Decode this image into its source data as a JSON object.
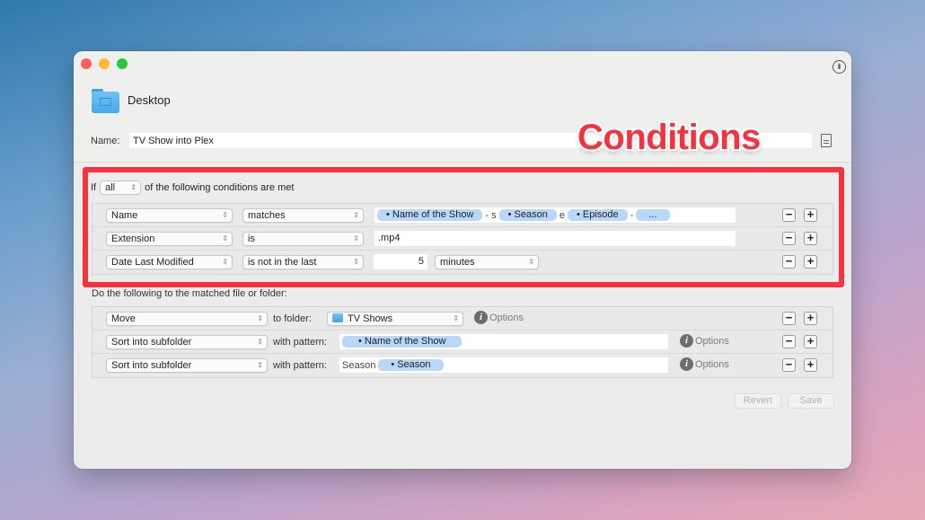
{
  "window": {
    "location": "Desktop",
    "name_label": "Name:",
    "name_value": "TV Show into Plex"
  },
  "conditions": {
    "if_prefix": "If",
    "match_mode": "all",
    "if_suffix": "of the following conditions are met",
    "rows": [
      {
        "attribute": "Name",
        "operator": "matches",
        "pattern": [
          {
            "type": "token",
            "text": "• Name of the Show"
          },
          {
            "type": "text",
            "text": "- s"
          },
          {
            "type": "token",
            "text": "• Season"
          },
          {
            "type": "text",
            "text": "e"
          },
          {
            "type": "token",
            "text": "• Episode"
          },
          {
            "type": "text",
            "text": "-"
          },
          {
            "type": "token",
            "text": "..."
          }
        ]
      },
      {
        "attribute": "Extension",
        "operator": "is",
        "value": ".mp4"
      },
      {
        "attribute": "Date Last Modified",
        "operator": "is not in the last",
        "amount": "5",
        "unit": "minutes"
      }
    ]
  },
  "actions": {
    "label": "Do the following to the matched file or folder:",
    "rows": [
      {
        "action": "Move",
        "connector": "to folder:",
        "folder": "TV Shows",
        "options": "Options"
      },
      {
        "action": "Sort into subfolder",
        "connector": "with pattern:",
        "pattern_text": "",
        "token": "• Name of the Show",
        "options": "Options"
      },
      {
        "action": "Sort into subfolder",
        "connector": "with pattern:",
        "pattern_text": "Season",
        "token": "• Season",
        "options": "Options"
      }
    ]
  },
  "buttons": {
    "revert": "Revert",
    "save": "Save",
    "minus": "−",
    "plus": "+"
  },
  "icons": {
    "pin": "⇟",
    "chevron": "⌃⌄",
    "info": "i"
  },
  "annotation": {
    "label": "Conditions",
    "color": "#f5333f"
  }
}
